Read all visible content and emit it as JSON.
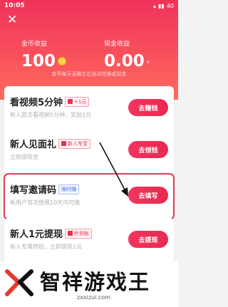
{
  "status_bar": {
    "time": "10:05",
    "battery": "40"
  },
  "header": {
    "coin_label": "金币收益",
    "coin_value": "100",
    "cash_label": "现金收益",
    "cash_value": "0.00",
    "note": "金币每天凌晨左右自动兑换成现金"
  },
  "cards": [
    {
      "title": "看视频5分钟",
      "badge": "+1元",
      "desc": "新人首次看视频5分钟，奖励1元",
      "button": "去赚钱"
    },
    {
      "title": "新人见面礼",
      "badge": "新人专享",
      "desc": "立刻领现金",
      "button": "去领钱"
    },
    {
      "title": "填写邀请码",
      "badge": "限时赚",
      "desc": "新用户首次使用10天内可填",
      "button": "去填写"
    },
    {
      "title": "新人1元提现",
      "badge": "秒到帐",
      "desc": "新人专属特权，立即提现1元",
      "button": "去提现"
    }
  ],
  "watermark": {
    "title": "智祥游戏王",
    "url": "zxxizui.com"
  },
  "colors": {
    "accent": "#f0325a",
    "button": "#e9294f"
  }
}
